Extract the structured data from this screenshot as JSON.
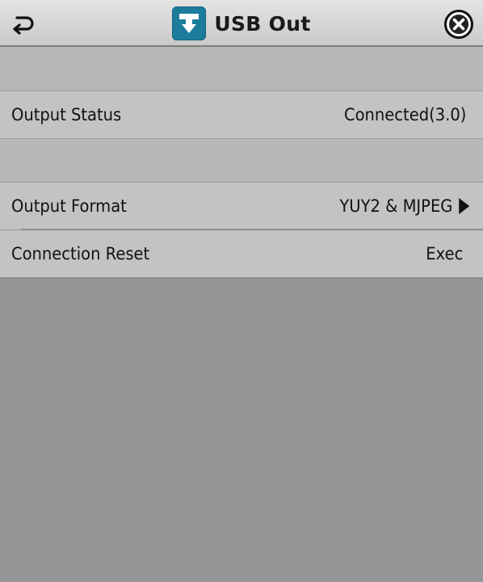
{
  "header": {
    "title": "USB Out",
    "back_icon": "back-arrow-icon",
    "app_icon": "usb-out-icon",
    "close_icon": "close-icon",
    "accent_color": "#1b7c9c"
  },
  "rows": {
    "output_status": {
      "label": "Output Status",
      "value": "Connected(3.0)"
    },
    "output_format": {
      "label": "Output Format",
      "value": "YUY2 & MJPEG"
    },
    "connection_reset": {
      "label": "Connection Reset",
      "value": "Exec"
    }
  }
}
